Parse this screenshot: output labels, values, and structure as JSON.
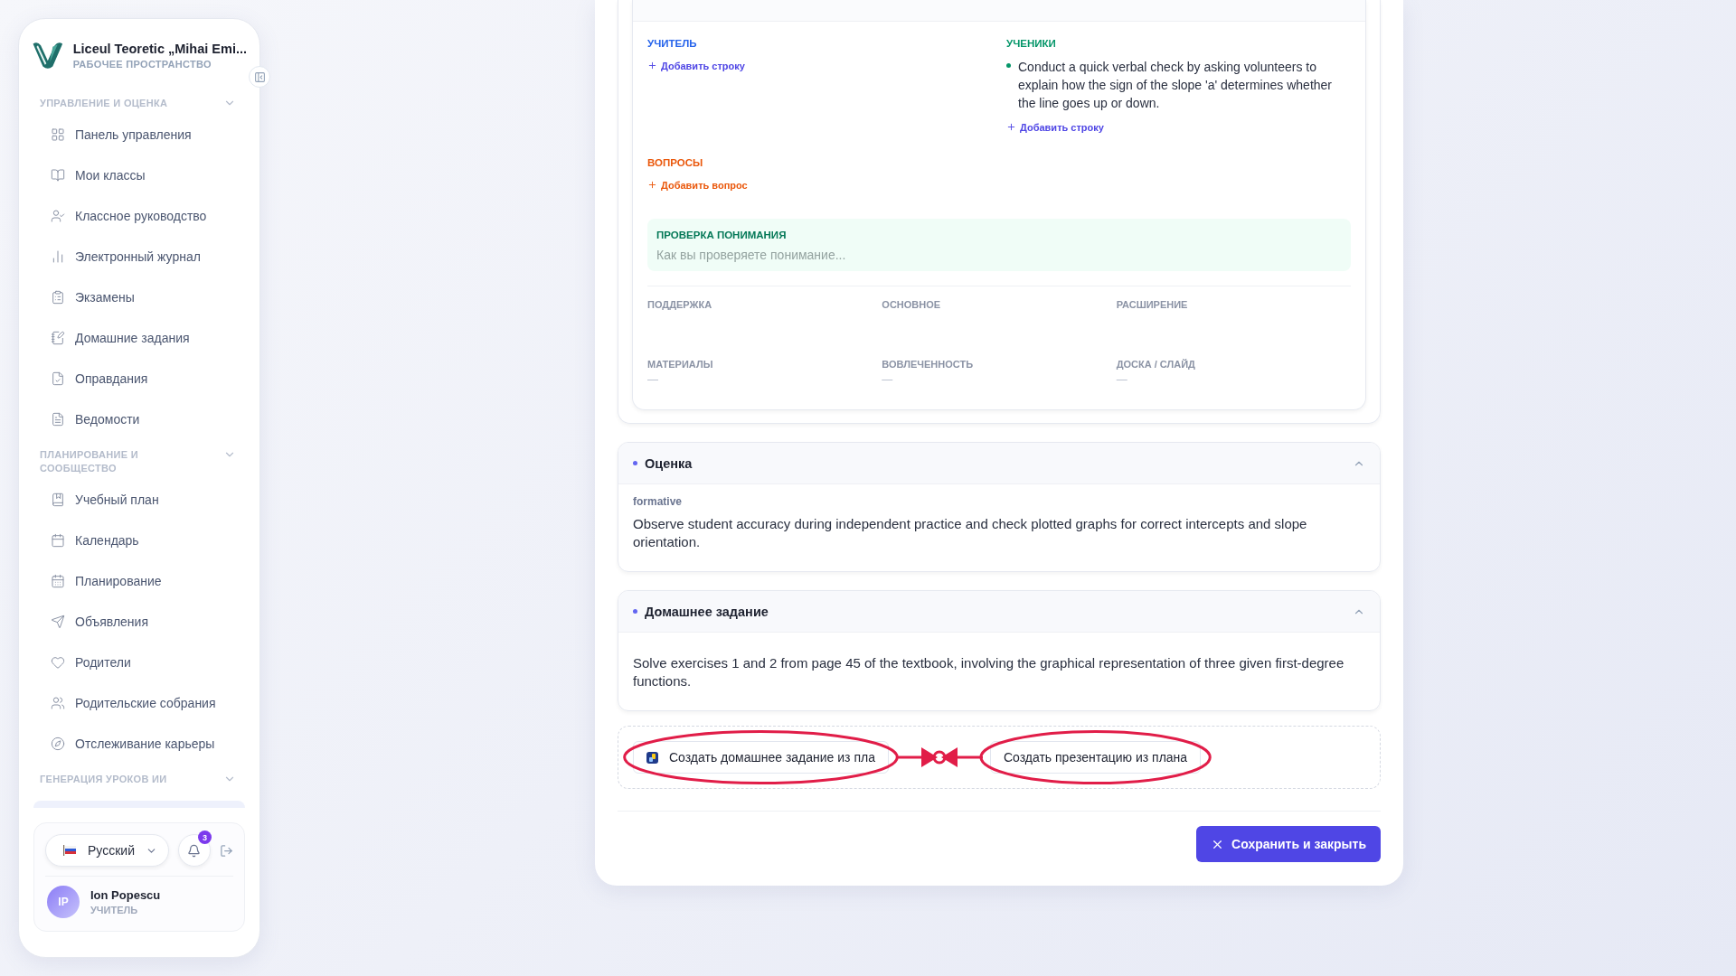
{
  "sidebar": {
    "school": "Liceul Teoretic „Mihai Emi...",
    "workspace": "РАБОЧЕЕ ПРОСТРАНСТВО",
    "sections": [
      {
        "title": "УПРАВЛЕНИЕ И ОЦЕНКА",
        "expanded": true,
        "items": [
          "Панель управления",
          "Мои классы",
          "Классное руководство",
          "Электронный журнал",
          "Экзамены",
          "Домашние задания",
          "Оправдания",
          "Ведомости"
        ]
      },
      {
        "title": "ПЛАНИРОВАНИЕ И СООБЩЕСТВО",
        "expanded": true,
        "items": [
          "Учебный план",
          "Календарь",
          "Планирование",
          "Объявления",
          "Родители",
          "Родительские собрания",
          "Отслеживание карьеры"
        ]
      },
      {
        "title": "ГЕНЕРАЦИЯ УРОКОВ ИИ",
        "expanded": true
      }
    ],
    "language": "Русский",
    "notifications": "3",
    "user": {
      "initials": "IP",
      "name": "Ion Popescu",
      "role": "УЧИТЕЛЬ"
    }
  },
  "plan": {
    "teacher": {
      "title": "УЧИТЕЛЬ",
      "add": "Добавить строку"
    },
    "students": {
      "title": "УЧЕНИКИ",
      "items": [
        "Conduct a quick verbal check by asking volunteers to explain how the sign of the slope 'a' determines whether the line goes up or down."
      ],
      "add": "Добавить строку"
    },
    "questions": {
      "title": "ВОПРОСЫ",
      "add": "Добавить вопрос"
    },
    "check": {
      "title": "ПРОВЕРКА ПОНИМАНИЯ",
      "placeholder": "Как вы проверяете понимание..."
    },
    "fields": [
      {
        "label": "ПОДДЕРЖКА"
      },
      {
        "label": "ОСНОВНОЕ"
      },
      {
        "label": "РАСШИРЕНИЕ"
      },
      {
        "label": "МАТЕРИАЛЫ",
        "value": "—"
      },
      {
        "label": "ВОВЛЕЧЕННОСТЬ",
        "value": "—"
      },
      {
        "label": "ДОСКА / СЛАЙД",
        "value": "—"
      }
    ]
  },
  "sections": [
    {
      "title": "Оценка",
      "expanded": true,
      "type": "formative",
      "text": "Observe student accuracy during independent practice and check plotted graphs for correct intercepts and slope orientation."
    },
    {
      "title": "Домашнее задание",
      "expanded": true,
      "text": "Solve exercises 1 and 2 from page 45 of the textbook, involving the graphical representation of three given first-degree functions."
    }
  ],
  "actions": [
    "Создать домашнее задание из пла",
    "Создать презентацию из плана"
  ],
  "save": "Сохранить и закрыть"
}
